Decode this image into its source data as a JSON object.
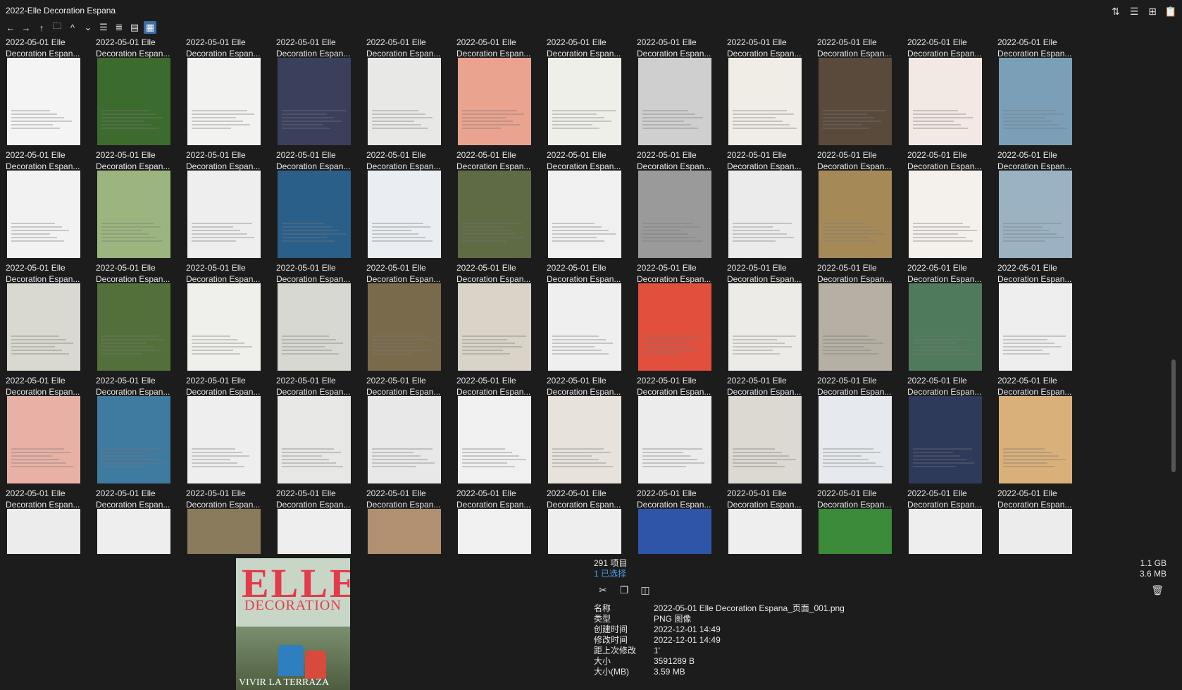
{
  "window": {
    "title": "2022-Elle Decoration Espana"
  },
  "top_right_icons": [
    "sort-icon",
    "list-view-icon",
    "new-window-icon",
    "clipboard-icon"
  ],
  "toolbar": {
    "buttons": [
      {
        "name": "back-icon",
        "glyph": "←"
      },
      {
        "name": "forward-icon",
        "glyph": "→"
      },
      {
        "name": "up-icon",
        "glyph": "↑"
      },
      {
        "name": "folder-icon",
        "glyph": "🗀"
      },
      {
        "name": "chevron-up-icon",
        "glyph": "^"
      },
      {
        "name": "chevron-down-icon",
        "glyph": "⌄"
      },
      {
        "name": "details-view-icon",
        "glyph": "☰"
      },
      {
        "name": "list-view-icon",
        "glyph": "≣"
      },
      {
        "name": "tiles-view-icon",
        "glyph": "▤"
      },
      {
        "name": "thumbnail-view-icon",
        "glyph": "▦"
      }
    ]
  },
  "file_label": {
    "line1": "2022-05-01 Elle",
    "line2": "Decoration Espan..."
  },
  "grid": {
    "columns": 12,
    "rows": 5
  },
  "status": {
    "item_count": "291 项目",
    "selected": "1 已选择",
    "total_size": "1.1 GB",
    "selected_size": "3.6 MB"
  },
  "preview": {
    "masthead": "ELLE",
    "subtitle": "DECORATION",
    "cover_line": "VIVIR LA TERRAZA"
  },
  "properties": [
    {
      "key": "名称",
      "value": "2022-05-01 Elle Decoration Espana_页面_001.png"
    },
    {
      "key": "类型",
      "value": "PNG 图像"
    },
    {
      "key": "创建时间",
      "value": "2022-12-01  14:49"
    },
    {
      "key": "修改时间",
      "value": "2022-12-01  14:49"
    },
    {
      "key": "距上次修改",
      "value": "1'"
    },
    {
      "key": "大小",
      "value": "3591289 B"
    },
    {
      "key": "大小(MB)",
      "value": "3.59 MB"
    }
  ],
  "thumb_colors": [
    [
      "#f4f4f4",
      "#3c6b2e",
      "#f2f2f0",
      "#3a3f5c",
      "#e8e8e6",
      "#e9a38f",
      "#efefe9",
      "#cfcfcf",
      "#f0ece6",
      "#5a4a3c",
      "#f2e8e4",
      "#7a9fb7"
    ],
    [
      "#f2f2f2",
      "#9cb57e",
      "#eeeeee",
      "#2a5f8a",
      "#eaeef2",
      "#5e6b45",
      "#f0f0f0",
      "#9a9a9a",
      "#ebebeb",
      "#a58a58",
      "#f4f0ec",
      "#9ab2c2"
    ],
    [
      "#d9d9cf",
      "#54703a",
      "#efefeb",
      "#d8d8d2",
      "#7a6a4c",
      "#d9d3c8",
      "#efefef",
      "#e24f3c",
      "#ecebe7",
      "#b6b0a4",
      "#4f7a5c",
      "#eeeeee"
    ],
    [
      "#e9b1a6",
      "#3f7aa0",
      "#eeeeee",
      "#e7e7e5",
      "#e8e8e8",
      "#f0f0f0",
      "#e7e3dc",
      "#ececec",
      "#dcd8d2",
      "#e6eaee",
      "#2e3a5a",
      "#d9b07a"
    ],
    [
      "#ececec",
      "#eeeeee",
      "#8a7a5c",
      "#eeeeee",
      "#b09070",
      "#f0f0f0",
      "#eeeeee",
      "#2f55a8",
      "#eeeeee",
      "#3a8a3a",
      "#eeeeee",
      "#ececec"
    ]
  ]
}
